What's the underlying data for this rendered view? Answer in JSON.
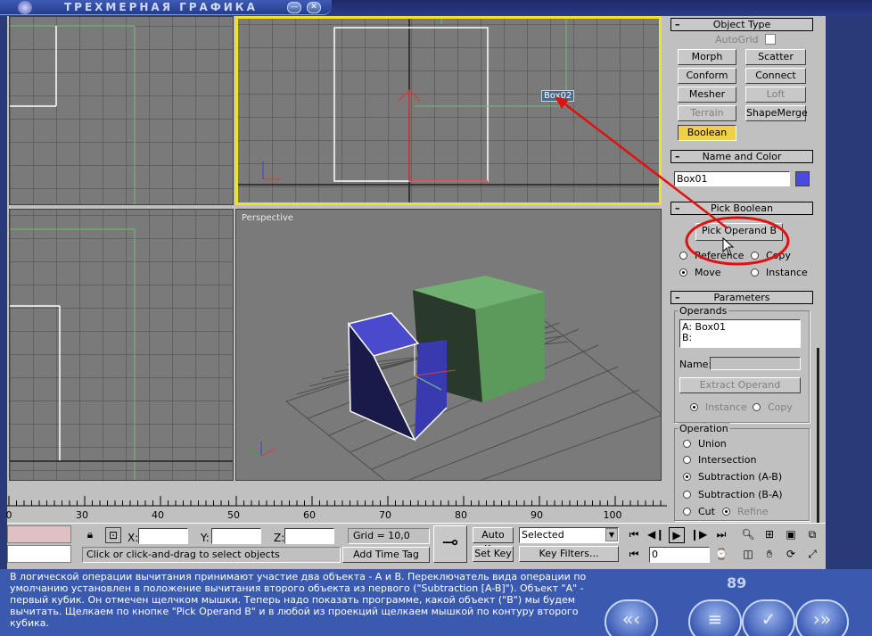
{
  "app": {
    "title": "ТРЕХМЕРНАЯ ГРАФИКА"
  },
  "viewports": {
    "perspective_label": "Perspective",
    "box02_label": "Box02"
  },
  "command_panel": {
    "object_type": {
      "header": "Object Type",
      "autogrid_label": "AutoGrid",
      "buttons": [
        "Morph",
        "Scatter",
        "Conform",
        "Connect",
        "Mesher",
        "Loft",
        "Terrain",
        "ShapeMerge",
        "Boolean"
      ]
    },
    "name_and_color": {
      "header": "Name and Color",
      "name_value": "Box01",
      "color": "#4040e0"
    },
    "pick_boolean": {
      "header": "Pick Boolean",
      "pick_button": "Pick Operand B",
      "radio_reference": "Reference",
      "radio_copy": "Copy",
      "radio_move": "Move",
      "radio_instance": "Instance"
    },
    "parameters": {
      "header": "Parameters",
      "operands_label": "Operands",
      "operand_a": "A: Box01",
      "operand_b": "B:",
      "name_label": "Name:",
      "extract_button": "Extract Operand",
      "radio_instance": "Instance",
      "radio_copy": "Copy",
      "operation_label": "Operation",
      "op_union": "Union",
      "op_intersection": "Intersection",
      "op_sub_ab": "Subtraction (A-B)",
      "op_sub_ba": "Subtraction (B-A)",
      "op_cut": "Cut",
      "op_refine": "Refine"
    }
  },
  "ruler": {
    "labels": [
      "0",
      "30",
      "40",
      "50",
      "60",
      "70",
      "80",
      "90",
      "100"
    ]
  },
  "status": {
    "x_label": "X:",
    "y_label": "Y:",
    "z_label": "Z:",
    "grid": "Grid = 10,0",
    "auto_key": "Auto Key",
    "set_key": "Set Key",
    "selected": "Selected",
    "key_filters": "Key Filters...",
    "prompt": "Click or click-and-drag to select objects",
    "add_time_tag": "Add Time Tag",
    "frame": "0"
  },
  "tutorial": {
    "text": "В логической операции вычитания принимают участие два объекта - А и В. Переключатель вида операции по умолчанию установлен в положение вычитания второго объекта из первого (\"Subtraction [A-B]\"). Объект \"А\" - первый кубик. Он отмечен щелчком мышки. Теперь надо показать программе, какой объект (\"В\") мы будем вычитать. Щелкаем по кнопке \"Pick Operand B\" и в любой из проекций щелкаем мышкой по контуру второго кубика.",
    "page": "89"
  },
  "colors": {
    "highlight": "#e01010",
    "active_viewport": "#f0e030",
    "boolean_active": "#f0d048"
  }
}
